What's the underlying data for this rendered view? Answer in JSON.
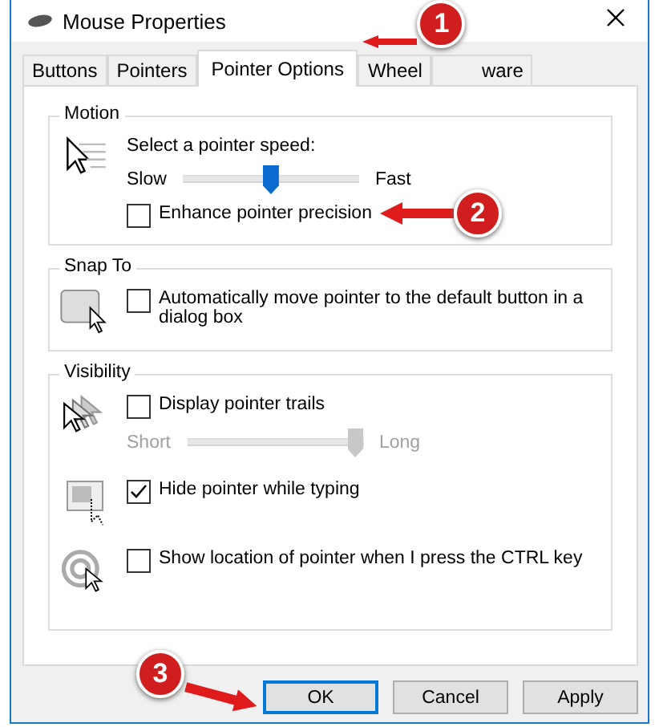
{
  "window": {
    "title": "Mouse Properties"
  },
  "tabs": [
    {
      "label": "Buttons",
      "selected": false
    },
    {
      "label": "Pointers",
      "selected": false
    },
    {
      "label": "Pointer Options",
      "selected": true
    },
    {
      "label": "Wheel",
      "selected": false
    },
    {
      "label": "ware",
      "selected": false
    }
  ],
  "groups": [
    {
      "title": "Motion",
      "rows": [
        {
          "kind": "slider",
          "label": "Select a pointer speed:",
          "min_label": "Slow",
          "max_label": "Fast",
          "level": 0.5,
          "disabled": false
        },
        {
          "kind": "checkbox",
          "label": "Enhance pointer precision",
          "checked": false
        }
      ]
    },
    {
      "title": "Snap To",
      "rows": [
        {
          "kind": "checkbox",
          "label": "Automatically move pointer to the default button in a dialog box",
          "checked": false
        }
      ]
    },
    {
      "title": "Visibility",
      "rows": [
        {
          "kind": "checkbox",
          "label": "Display pointer trails",
          "checked": false
        },
        {
          "kind": "slider",
          "min_label": "Short",
          "max_label": "Long",
          "level": 1.0,
          "disabled": true
        },
        {
          "kind": "checkbox",
          "label": "Hide pointer while typing",
          "checked": true
        },
        {
          "kind": "checkbox",
          "label": "Show location of pointer when I press the CTRL key",
          "checked": false
        }
      ]
    }
  ],
  "buttons": [
    {
      "label": "OK",
      "default": true
    },
    {
      "label": "Cancel",
      "default": false
    },
    {
      "label": "Apply",
      "default": false
    }
  ],
  "callouts": [
    {
      "number": "1"
    },
    {
      "number": "2"
    },
    {
      "number": "3"
    }
  ]
}
